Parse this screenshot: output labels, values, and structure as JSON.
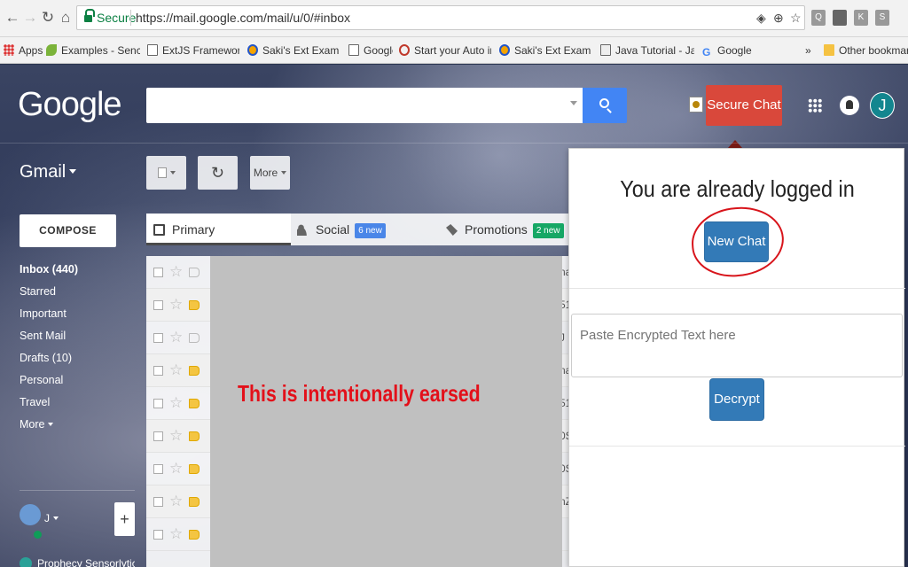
{
  "browser": {
    "secure_label": "Secure",
    "url": "https://mail.google.com/mail/u/0/#inbox",
    "bookmarks": [
      {
        "label": "Apps",
        "icon": "apps-icon"
      },
      {
        "label": "Examples - Sencha Do",
        "icon": "sencha-icon"
      },
      {
        "label": "ExtJS Framework | Qu",
        "icon": "page-icon"
      },
      {
        "label": "Saki's Ext Examples Pa",
        "icon": "saki-icon"
      },
      {
        "label": "Google",
        "icon": "page-icon"
      },
      {
        "label": "Start your Auto insura",
        "icon": "insurance-icon"
      },
      {
        "label": "Saki's Ext Examples Pa",
        "icon": "saki-icon"
      },
      {
        "label": "Java Tutorial - Java In",
        "icon": "java-icon"
      },
      {
        "label": "Google",
        "icon": "google-icon"
      }
    ],
    "overflow": "»",
    "other_bookmarks": "Other bookmarks",
    "extensions": [
      "Q",
      "",
      "K",
      "S"
    ]
  },
  "gmail": {
    "logo": "Google",
    "search_placeholder": "",
    "secure_chat_label": "Secure Chat",
    "avatar_initial": "J",
    "app_label": "Gmail",
    "toolbar": {
      "more_label": "More"
    },
    "compose_label": "COMPOSE",
    "sidebar": [
      {
        "label": "Inbox (440)",
        "bold": true
      },
      {
        "label": "Starred"
      },
      {
        "label": "Important"
      },
      {
        "label": "Sent Mail"
      },
      {
        "label": "Drafts (10)"
      },
      {
        "label": "Personal"
      },
      {
        "label": "Travel"
      },
      {
        "label": "More"
      }
    ],
    "user_label": "J",
    "hangout_contact": "Prophecy Sensorlytics",
    "tabs": [
      {
        "label": "Primary",
        "badge": ""
      },
      {
        "label": "Social",
        "badge": "6 new",
        "badge_color": "#4a86e8"
      },
      {
        "label": "Promotions",
        "badge": "2 new",
        "badge_color": "#16a765"
      }
    ],
    "row_fragments": [
      "na",
      "51",
      "J",
      "",
      "na",
      "51",
      "0S",
      "0S",
      "nZ",
      ""
    ],
    "erased_text": "This is intentionally earsed"
  },
  "popup": {
    "title": "You are already logged in",
    "new_chat_label": "New Chat",
    "encrypted_placeholder": "Paste Encrypted Text here",
    "decrypt_label": "Decrypt"
  }
}
